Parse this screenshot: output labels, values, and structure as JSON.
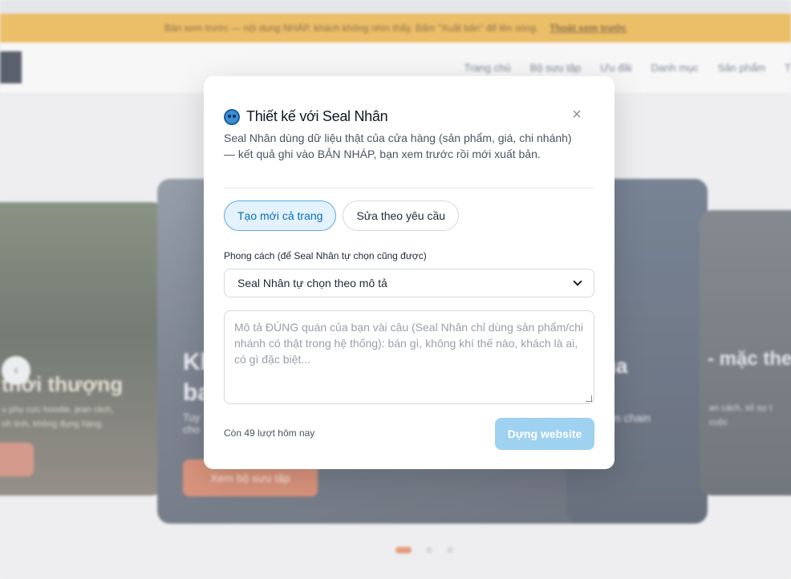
{
  "banner": {
    "text": "Bản xem trước — nội dung NHÁP, khách không nhìn thấy. Bấm \"Xuất bản\" để lên sóng.",
    "exit_link": "Thoát xem trước"
  },
  "nav": {
    "links": [
      "Trang chủ",
      "Bộ sưu tập",
      "Ưu đãi",
      "Danh mục",
      "Sản phẩm",
      "T"
    ]
  },
  "hero": {
    "left_card": {
      "title": "thời thượng",
      "subtitle": "u phụ cực hoodie, jean rách,\nnh tinh, không đụng hàng."
    },
    "main_card": {
      "title": "Kh\nba",
      "subtitle": "Tuy\ncho",
      "button": "Xem bộ sưu tập"
    },
    "right_card": {
      "title": "ủa",
      "subtitle": "ện chain"
    },
    "far_card": {
      "title": "- mặc the",
      "subtitle": "an cách, số sự t\ncuộc"
    }
  },
  "modal": {
    "title": "Thiết kế với Seal Nhân",
    "icon": "seal-icon",
    "close_glyph": "×",
    "description": "Seal Nhân dùng dữ liệu thật của cửa hàng (sản phẩm, giá, chi nhánh) — kết quả ghi vào BẢN NHÁP, bạn xem trước rồi mới xuất bản.",
    "tabs": [
      {
        "label": "Tạo mới cả trang",
        "active": true
      },
      {
        "label": "Sửa theo yêu cầu",
        "active": false
      }
    ],
    "style_label": "Phong cách (để Seal Nhân tự chọn cũng được)",
    "style_selected": "Seal Nhân tự chọn theo mô tả",
    "prompt_placeholder": "Mô tả ĐÚNG quán của bạn vài câu (Seal Nhân chỉ dùng sản phẩm/chi nhánh có thật trong hệ thống): bán gì, không khí thế nào, khách là ai, có gì đặc biệt...",
    "quota_text": "Còn 49 lượt hôm nay",
    "build_button": "Dựng website"
  },
  "colors": {
    "banner": "#e4a52f",
    "accent": "#5aa8e6",
    "build_button": "#9fd1f0",
    "carousel_active_dot": "#d9744c"
  }
}
